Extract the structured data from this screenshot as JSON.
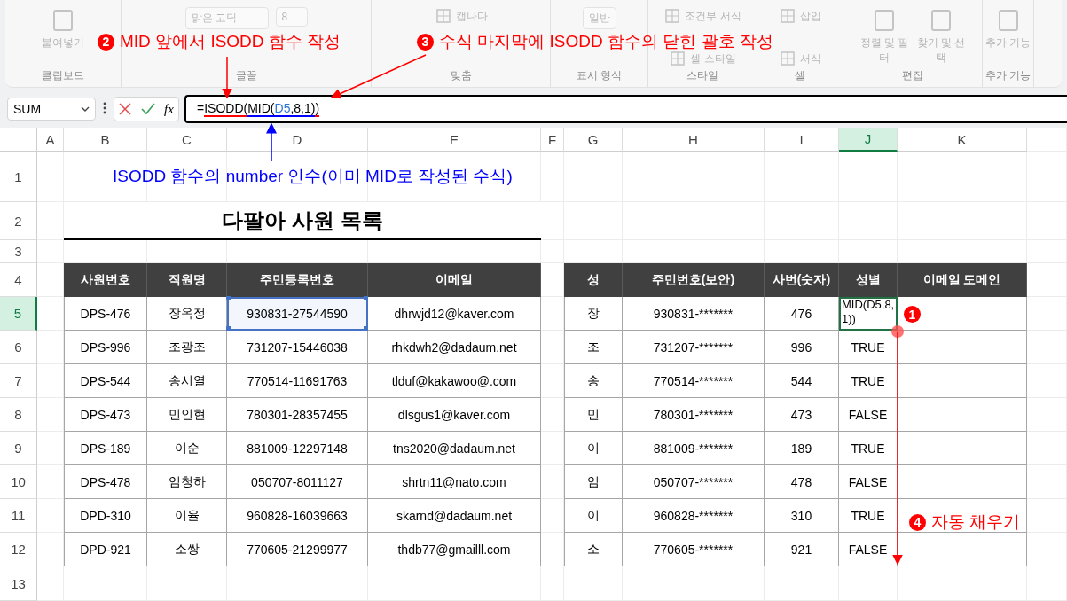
{
  "ribbon": {
    "groups": [
      {
        "label": "클립보드",
        "commands": [
          {
            "kind": "large",
            "text": "붙여넣기"
          }
        ]
      },
      {
        "label": "글꼴",
        "commands": [
          {
            "kind": "field",
            "text": "맑은 고딕"
          },
          {
            "kind": "field",
            "text": "8"
          }
        ]
      },
      {
        "label": "맞춤",
        "commands": [
          {
            "kind": "small",
            "text": "캡나다"
          }
        ]
      },
      {
        "label": "표시 형식",
        "commands": [
          {
            "kind": "field",
            "text": "일반"
          }
        ]
      },
      {
        "label": "스타일",
        "commands": [
          {
            "kind": "small",
            "text": "조건부 서식"
          },
          {
            "kind": "small",
            "text": "셀 스타일"
          }
        ]
      },
      {
        "label": "셀",
        "commands": [
          {
            "kind": "small",
            "text": "삽입"
          },
          {
            "kind": "small",
            "text": "서식"
          }
        ]
      },
      {
        "label": "편집",
        "commands": [
          {
            "kind": "large",
            "text": "정렬 및 필터"
          },
          {
            "kind": "large",
            "text": "찾기 및 선택"
          }
        ]
      },
      {
        "label": "추가 기능",
        "commands": [
          {
            "kind": "large",
            "text": "추가 기능"
          }
        ]
      }
    ]
  },
  "formula_bar": {
    "name_box": "SUM",
    "fx": "fx",
    "formula": [
      {
        "text": "="
      },
      {
        "text": "ISODD(",
        "underline": {
          "color": "#ff0000"
        }
      },
      {
        "text": "MID(",
        "underline": {
          "color": "#0000ff"
        }
      },
      {
        "text": "D5",
        "color": "#2e75d6",
        "underline": {
          "color": "#0000ff"
        }
      },
      {
        "text": ",8,1)",
        "underline": {
          "color": "#0000ff"
        }
      },
      {
        "text": ")",
        "underline": {
          "color": "#ff0000"
        }
      }
    ]
  },
  "sheet": {
    "columns": [
      {
        "label": "A",
        "selected": false
      },
      {
        "label": "B",
        "selected": false
      },
      {
        "label": "C",
        "selected": false
      },
      {
        "label": "D",
        "selected": false
      },
      {
        "label": "E",
        "selected": false
      },
      {
        "label": "F",
        "selected": false
      },
      {
        "label": "G",
        "selected": false
      },
      {
        "label": "H",
        "selected": false
      },
      {
        "label": "I",
        "selected": false
      },
      {
        "label": "J",
        "selected": true
      },
      {
        "label": "K",
        "selected": false
      }
    ],
    "row_numbers": [
      {
        "label": "1",
        "selected": false
      },
      {
        "label": "2",
        "selected": false
      },
      {
        "label": "3",
        "selected": false
      },
      {
        "label": "4",
        "selected": false
      },
      {
        "label": "5",
        "selected": true
      },
      {
        "label": "6",
        "selected": false
      },
      {
        "label": "7",
        "selected": false
      },
      {
        "label": "8",
        "selected": false
      },
      {
        "label": "9",
        "selected": false
      },
      {
        "label": "10",
        "selected": false
      },
      {
        "label": "11",
        "selected": false
      },
      {
        "label": "12",
        "selected": false
      },
      {
        "label": "13",
        "selected": false
      }
    ],
    "title": "다팔아 사원 목록",
    "employees": {
      "headers": [
        "사원번호",
        "직원명",
        "주민등록번호",
        "이메일"
      ],
      "rows": [
        {
          "cells": [
            "DPS-476",
            "장옥정",
            "930831-27544590",
            "dhrwjd12@kaver.com"
          ],
          "referenced": true
        },
        {
          "cells": [
            "DPS-996",
            "조광조",
            "731207-15446038",
            "rhkdwh2@dadaum.net"
          ],
          "referenced": false
        },
        {
          "cells": [
            "DPS-544",
            "송시열",
            "770514-11691763",
            "tlduf@kakawoo@.com"
          ],
          "referenced": false
        },
        {
          "cells": [
            "DPS-473",
            "민인현",
            "780301-28357455",
            "dlsgus1@kaver.com"
          ],
          "referenced": false
        },
        {
          "cells": [
            "DPS-189",
            "이순",
            "881009-12297148",
            "tns2020@dadaum.net"
          ],
          "referenced": false
        },
        {
          "cells": [
            "DPS-478",
            "임청하",
            "050707-8011127",
            "shrtn11@nato.com"
          ],
          "referenced": false
        },
        {
          "cells": [
            "DPD-310",
            "이율",
            "960828-16039663",
            "skarnd@dadaum.net"
          ],
          "referenced": false
        },
        {
          "cells": [
            "DPD-921",
            "소쌍",
            "770605-21299977",
            "thdb77@gmailll.com"
          ],
          "referenced": false
        }
      ]
    },
    "derived": {
      "headers": [
        "성",
        "주민번호(보안)",
        "사번(숫자)",
        "성별",
        "이메일 도메인"
      ],
      "rows": [
        {
          "cells": [
            "장",
            "930831-*******",
            "476",
            "MID(D5,8,1))",
            ""
          ],
          "editing": true
        },
        {
          "cells": [
            "조",
            "731207-*******",
            "996",
            "TRUE",
            ""
          ],
          "editing": false
        },
        {
          "cells": [
            "송",
            "770514-*******",
            "544",
            "TRUE",
            ""
          ],
          "editing": false
        },
        {
          "cells": [
            "민",
            "780301-*******",
            "473",
            "FALSE",
            ""
          ],
          "editing": false
        },
        {
          "cells": [
            "이",
            "881009-*******",
            "189",
            "TRUE",
            ""
          ],
          "editing": false
        },
        {
          "cells": [
            "임",
            "050707-*******",
            "478",
            "FALSE",
            ""
          ],
          "editing": false
        },
        {
          "cells": [
            "이",
            "960828-*******",
            "310",
            "TRUE",
            ""
          ],
          "editing": false
        },
        {
          "cells": [
            "소",
            "770605-*******",
            "921",
            "FALSE",
            ""
          ],
          "editing": false
        }
      ]
    }
  },
  "annotations": [
    {
      "number": "2",
      "text": "MID 앞에서 ISODD 함수 작성",
      "color": "#ff0000"
    },
    {
      "number": "3",
      "text": "수식 마지막에 ISODD 함수의 닫힌 괄호 작성",
      "color": "#ff0000"
    },
    {
      "text": "ISODD 함수의 number 인수(이미 MID로 작성된 수식)",
      "color": "#0000ff"
    },
    {
      "number": "1",
      "color": "#ff0000"
    },
    {
      "number": "4",
      "text": "자동 채우기",
      "color": "#ff0000"
    }
  ]
}
